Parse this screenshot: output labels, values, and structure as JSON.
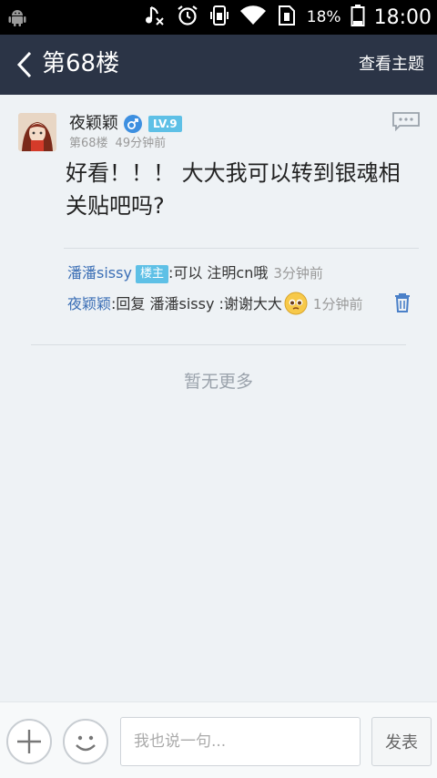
{
  "status_bar": {
    "battery_percent": "18%",
    "time": "18:00",
    "icons": [
      "android-icon",
      "music-off-icon",
      "alarm-icon",
      "vibrate-icon",
      "wifi-icon",
      "sim-icon",
      "battery-icon"
    ]
  },
  "header": {
    "title": "第68楼",
    "view_topic": "查看主题"
  },
  "post": {
    "username": "夜颖颖",
    "gender_icon": "male-icon",
    "level": "LV.9",
    "floor": "第68楼",
    "time": "49分钟前",
    "content": "好看！！！ 大大我可以转到银魂相关贴吧吗?"
  },
  "replies": [
    {
      "user": "潘潘sissy",
      "badge": "楼主",
      "separator": ":",
      "text": "可以 注明cn哦",
      "time": "3分钟前"
    },
    {
      "user": "夜颖颖",
      "separator": ":",
      "text": "回复 潘潘sissy :谢谢大大",
      "emoji": "pleading-face-icon",
      "time": "1分钟前"
    }
  ],
  "no_more": "暂无更多",
  "bottom_bar": {
    "placeholder": "我也说一句...",
    "send_label": "发表"
  },
  "colors": {
    "header_bg": "#2b3446",
    "link_blue": "#3a6eb5",
    "badge_blue": "#5ec0e6",
    "page_bg": "#eef2f5"
  }
}
